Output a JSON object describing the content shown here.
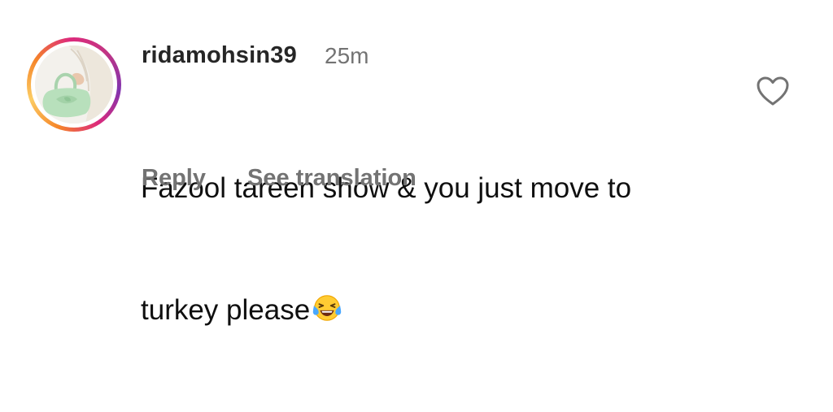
{
  "comment": {
    "username": "ridamohsin39",
    "timestamp": "25m",
    "text_line1": "Fazool tareen show & you just move to",
    "text_line2": "turkey please",
    "emoji": "face-with-tears-of-joy",
    "reply_label": "Reply",
    "translate_label": "See translation",
    "like_icon": "heart-outline-icon",
    "story_ring_colors": [
      "#f58529",
      "#fccc63",
      "#dd2a7b",
      "#c13584",
      "#8134af"
    ],
    "text_color": "#0f0f0f",
    "meta_color": "#737373"
  }
}
